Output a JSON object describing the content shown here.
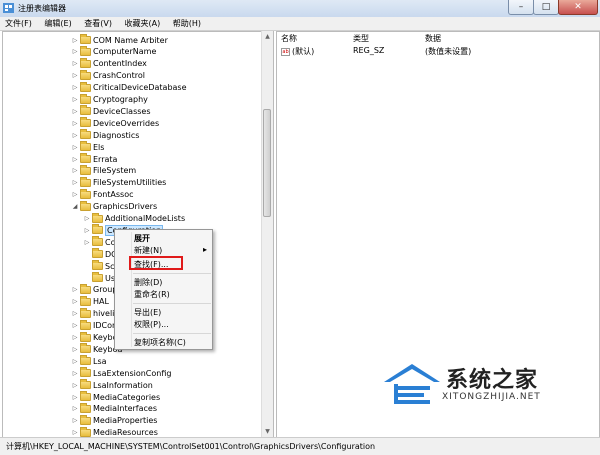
{
  "window": {
    "title": "注册表编辑器",
    "minimize": "–",
    "maximize": "□",
    "close": "✕"
  },
  "menu": [
    "文件(F)",
    "编辑(E)",
    "查看(V)",
    "收藏夹(A)",
    "帮助(H)"
  ],
  "tree": [
    {
      "label": "COM Name Arbiter",
      "arrow": "▷"
    },
    {
      "label": "ComputerName",
      "arrow": "▷"
    },
    {
      "label": "ContentIndex",
      "arrow": "▷"
    },
    {
      "label": "CrashControl",
      "arrow": "▷"
    },
    {
      "label": "CriticalDeviceDatabase",
      "arrow": "▷"
    },
    {
      "label": "Cryptography",
      "arrow": "▷"
    },
    {
      "label": "DeviceClasses",
      "arrow": "▷"
    },
    {
      "label": "DeviceOverrides",
      "arrow": "▷"
    },
    {
      "label": "Diagnostics",
      "arrow": "▷"
    },
    {
      "label": "Els",
      "arrow": "▷"
    },
    {
      "label": "Errata",
      "arrow": "▷"
    },
    {
      "label": "FileSystem",
      "arrow": "▷"
    },
    {
      "label": "FileSystemUtilities",
      "arrow": "▷"
    },
    {
      "label": "FontAssoc",
      "arrow": "▷"
    },
    {
      "label": "GraphicsDrivers",
      "arrow": "◢"
    },
    {
      "label": "AdditionalModeLists",
      "arrow": "▷"
    },
    {
      "label": "Configuration",
      "arrow": "▷"
    },
    {
      "label": "Cor",
      "arrow": "▷"
    },
    {
      "label": "DCI",
      "arrow": ""
    },
    {
      "label": "Sch",
      "arrow": ""
    },
    {
      "label": "Use",
      "arrow": ""
    },
    {
      "label": "GroupO",
      "arrow": "▷"
    },
    {
      "label": "HAL",
      "arrow": "▷"
    },
    {
      "label": "hivelist",
      "arrow": "▷"
    },
    {
      "label": "IDConf",
      "arrow": "▷"
    },
    {
      "label": "Keyboa",
      "arrow": "▷"
    },
    {
      "label": "Keyboa",
      "arrow": "▷"
    },
    {
      "label": "Lsa",
      "arrow": "▷"
    },
    {
      "label": "LsaExtensionConfig",
      "arrow": "▷"
    },
    {
      "label": "LsaInformation",
      "arrow": "▷"
    },
    {
      "label": "MediaCategories",
      "arrow": "▷"
    },
    {
      "label": "MediaInterfaces",
      "arrow": "▷"
    },
    {
      "label": "MediaProperties",
      "arrow": "▷"
    },
    {
      "label": "MediaResources",
      "arrow": "▷"
    }
  ],
  "columns": {
    "name": "名称",
    "type": "类型",
    "data": "数据"
  },
  "values": [
    {
      "icon": "ab",
      "name": "(默认)",
      "type": "REG_SZ",
      "data": "(数值未设置)"
    }
  ],
  "context_menu": {
    "expand": "展开",
    "new": "新建(N)",
    "submenu_arrow": "▸",
    "find": "查找(F)...",
    "delete": "删除(D)",
    "rename": "重命名(R)",
    "export": "导出(E)",
    "permissions": "权限(P)...",
    "copy_key_name": "复制项名称(C)"
  },
  "status_path": "计算机\\HKEY_LOCAL_MACHINE\\SYSTEM\\ControlSet001\\Control\\GraphicsDrivers\\Configuration",
  "watermark": {
    "brand": "系统之家",
    "url": "XITONGZHIJIA.NET"
  },
  "colors": {
    "selection": "#cde8ff",
    "highlight_box": "#e01a1a",
    "watermark_blue": "#2a7fd4"
  }
}
